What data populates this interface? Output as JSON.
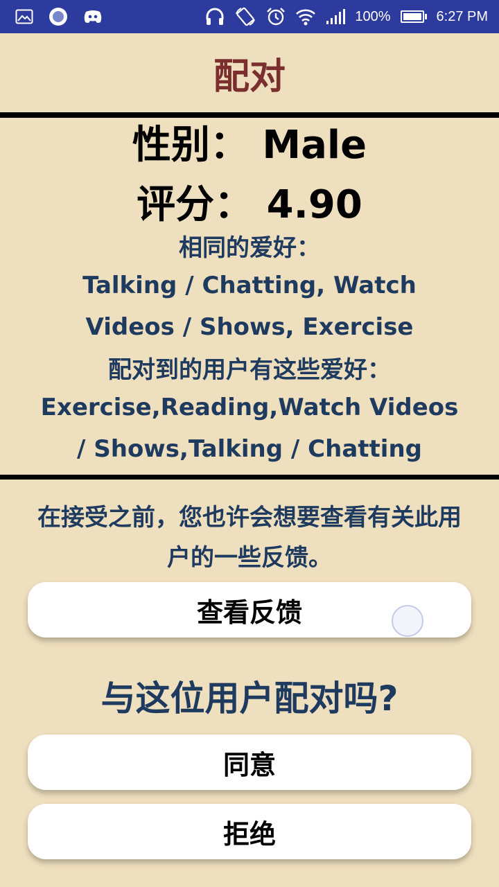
{
  "status_bar": {
    "battery": "100%",
    "time": "6:27 PM",
    "left_icons": [
      "gallery-icon",
      "circle-app-icon",
      "discord-icon"
    ],
    "right_icons": [
      "headphones-icon",
      "rotate-icon",
      "alarm-icon",
      "wifi-icon",
      "signal-icon",
      "battery-icon"
    ]
  },
  "header": {
    "title": "配对"
  },
  "info": {
    "gender_line": "性别：  Male",
    "rating_line": "评分：  4.90",
    "common_hobbies_label": "相同的爱好：",
    "common_hobbies": "Talking / Chatting, Watch Videos / Shows, Exercise",
    "match_hobbies_label": "配对到的用户有这些爱好：",
    "match_hobbies": "Exercise,Reading,Watch Videos / Shows,Talking / Chatting"
  },
  "feedback_prompt": "在接受之前，您也许会想要查看有关此用户的一些反馈。",
  "buttons": {
    "view_feedback": "查看反馈",
    "agree": "同意",
    "reject": "拒绝"
  },
  "question": "与这位用户配对吗?",
  "colors": {
    "status_bar": "#2d3a9e",
    "background": "#eedfbe",
    "title": "#7a2e2e",
    "accent_text": "#1e3a5f"
  }
}
